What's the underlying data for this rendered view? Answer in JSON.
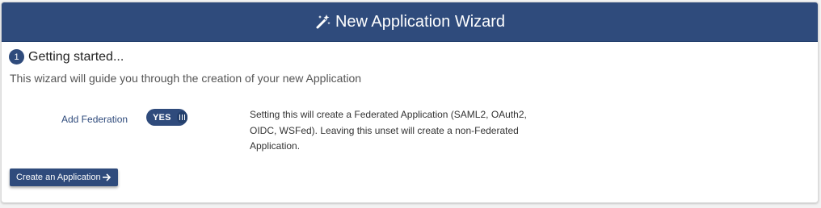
{
  "header": {
    "title": "New Application Wizard",
    "icon": "magic-wand-icon"
  },
  "step": {
    "number": "1",
    "title": "Getting started..."
  },
  "intro_text": "This wizard will guide you through the creation of your new Application",
  "federation": {
    "label": "Add Federation",
    "toggle_value": "YES",
    "help_text": "Setting this will create a Federated Application (SAML2, OAuth2, OIDC, WSFed). Leaving this unset will create a non-Federated Application."
  },
  "actions": {
    "create_label": "Create an Application",
    "create_icon": "arrow-right-icon"
  },
  "colors": {
    "primary": "#2f4b7c",
    "label": "#2f4b7c",
    "background": "#ffffff"
  }
}
